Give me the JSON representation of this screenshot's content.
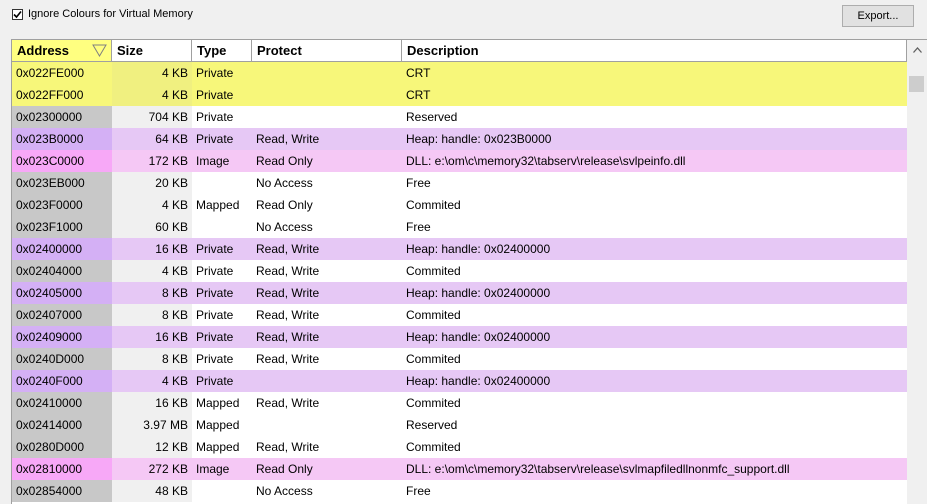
{
  "toolbar": {
    "ignore_colours_label": "Ignore Colours for Virtual Memory",
    "ignore_colours_checked": true,
    "export_label": "Export..."
  },
  "columns": [
    "Address",
    "Size",
    "Type",
    "Protect",
    "Description"
  ],
  "colors": {
    "crt": "#f7f77a",
    "heap": "#e6c8f5",
    "dll": "#f5c8f5",
    "reserved_addr": "#c8c8c8",
    "sorted_header": "#ffff80"
  },
  "rows": [
    {
      "address": "0x022FE000",
      "size": "4 KB",
      "type": "Private",
      "protect": "",
      "description": "CRT",
      "kind": "crt"
    },
    {
      "address": "0x022FF000",
      "size": "4 KB",
      "type": "Private",
      "protect": "",
      "description": "CRT",
      "kind": "crt"
    },
    {
      "address": "0x02300000",
      "size": "704 KB",
      "type": "Private",
      "protect": "",
      "description": "Reserved",
      "kind": "plain"
    },
    {
      "address": "0x023B0000",
      "size": "64 KB",
      "type": "Private",
      "protect": "Read, Write",
      "description": "Heap: handle: 0x023B0000",
      "kind": "heap"
    },
    {
      "address": "0x023C0000",
      "size": "172 KB",
      "type": "Image",
      "protect": "Read Only",
      "description": "DLL: e:\\om\\c\\memory32\\tabserv\\release\\svlpeinfo.dll",
      "kind": "dll"
    },
    {
      "address": "0x023EB000",
      "size": "20 KB",
      "type": "",
      "protect": "No Access",
      "description": "Free",
      "kind": "plain"
    },
    {
      "address": "0x023F0000",
      "size": "4 KB",
      "type": "Mapped",
      "protect": "Read Only",
      "description": "Commited",
      "kind": "plain"
    },
    {
      "address": "0x023F1000",
      "size": "60 KB",
      "type": "",
      "protect": "No Access",
      "description": "Free",
      "kind": "plain"
    },
    {
      "address": "0x02400000",
      "size": "16 KB",
      "type": "Private",
      "protect": "Read, Write",
      "description": "Heap: handle: 0x02400000",
      "kind": "heap"
    },
    {
      "address": "0x02404000",
      "size": "4 KB",
      "type": "Private",
      "protect": "Read, Write",
      "description": "Commited",
      "kind": "plain"
    },
    {
      "address": "0x02405000",
      "size": "8 KB",
      "type": "Private",
      "protect": "Read, Write",
      "description": "Heap: handle: 0x02400000",
      "kind": "heap"
    },
    {
      "address": "0x02407000",
      "size": "8 KB",
      "type": "Private",
      "protect": "Read, Write",
      "description": "Commited",
      "kind": "plain"
    },
    {
      "address": "0x02409000",
      "size": "16 KB",
      "type": "Private",
      "protect": "Read, Write",
      "description": "Heap: handle: 0x02400000",
      "kind": "heap"
    },
    {
      "address": "0x0240D000",
      "size": "8 KB",
      "type": "Private",
      "protect": "Read, Write",
      "description": "Commited",
      "kind": "plain"
    },
    {
      "address": "0x0240F000",
      "size": "4 KB",
      "type": "Private",
      "protect": "",
      "description": "Heap: handle: 0x02400000",
      "kind": "heap"
    },
    {
      "address": "0x02410000",
      "size": "16 KB",
      "type": "Mapped",
      "protect": "Read, Write",
      "description": "Commited",
      "kind": "plain"
    },
    {
      "address": "0x02414000",
      "size": "3.97 MB",
      "type": "Mapped",
      "protect": "",
      "description": "Reserved",
      "kind": "plain"
    },
    {
      "address": "0x0280D000",
      "size": "12 KB",
      "type": "Mapped",
      "protect": "Read, Write",
      "description": "Commited",
      "kind": "plain"
    },
    {
      "address": "0x02810000",
      "size": "272 KB",
      "type": "Image",
      "protect": "Read Only",
      "description": "DLL: e:\\om\\c\\memory32\\tabserv\\release\\svlmapfiledllnonmfc_support.dll",
      "kind": "dll"
    },
    {
      "address": "0x02854000",
      "size": "48 KB",
      "type": "",
      "protect": "No Access",
      "description": "Free",
      "kind": "plain"
    }
  ]
}
